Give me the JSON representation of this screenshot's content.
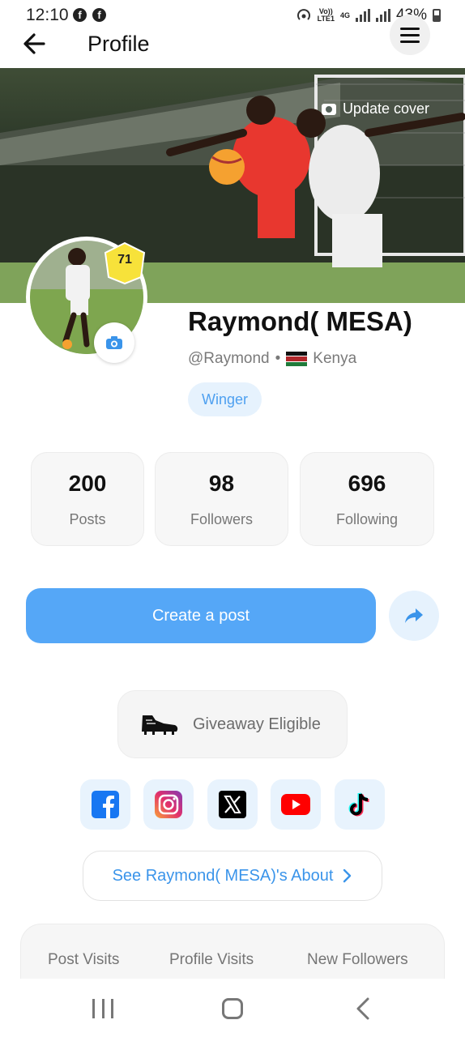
{
  "status_bar": {
    "time": "12:10",
    "network_top": "Vo))",
    "network_bottom": "LTE1",
    "net_gen": "4G",
    "battery": "43%",
    "fb_glyph": "f"
  },
  "header": {
    "title": "Profile"
  },
  "cover": {
    "update_label": "Update cover"
  },
  "profile": {
    "rating": "71",
    "name": "Raymond( MESA)",
    "handle": "@Raymond",
    "separator": "•",
    "country": "Kenya",
    "position": "Winger"
  },
  "stats": [
    {
      "value": "200",
      "label": "Posts"
    },
    {
      "value": "98",
      "label": "Followers"
    },
    {
      "value": "696",
      "label": "Following"
    }
  ],
  "actions": {
    "create_post": "Create a post"
  },
  "giveaway": {
    "label": "Giveaway Eligible",
    "icon": "football-boot-icon"
  },
  "socials": [
    {
      "name": "facebook",
      "color": "#1877f2"
    },
    {
      "name": "instagram",
      "color": "#e1306c"
    },
    {
      "name": "x",
      "color": "#000000"
    },
    {
      "name": "youtube",
      "color": "#ff0000"
    },
    {
      "name": "tiktok",
      "color": "#000000"
    }
  ],
  "about": {
    "label": "See Raymond( MESA)'s About"
  },
  "analytics": {
    "tabs": [
      "Post Visits",
      "Profile Visits",
      "New Followers"
    ]
  },
  "colors": {
    "accent": "#55a7f7",
    "accent_light": "#e6f2fd",
    "rating_badge": "#f7e23a"
  }
}
